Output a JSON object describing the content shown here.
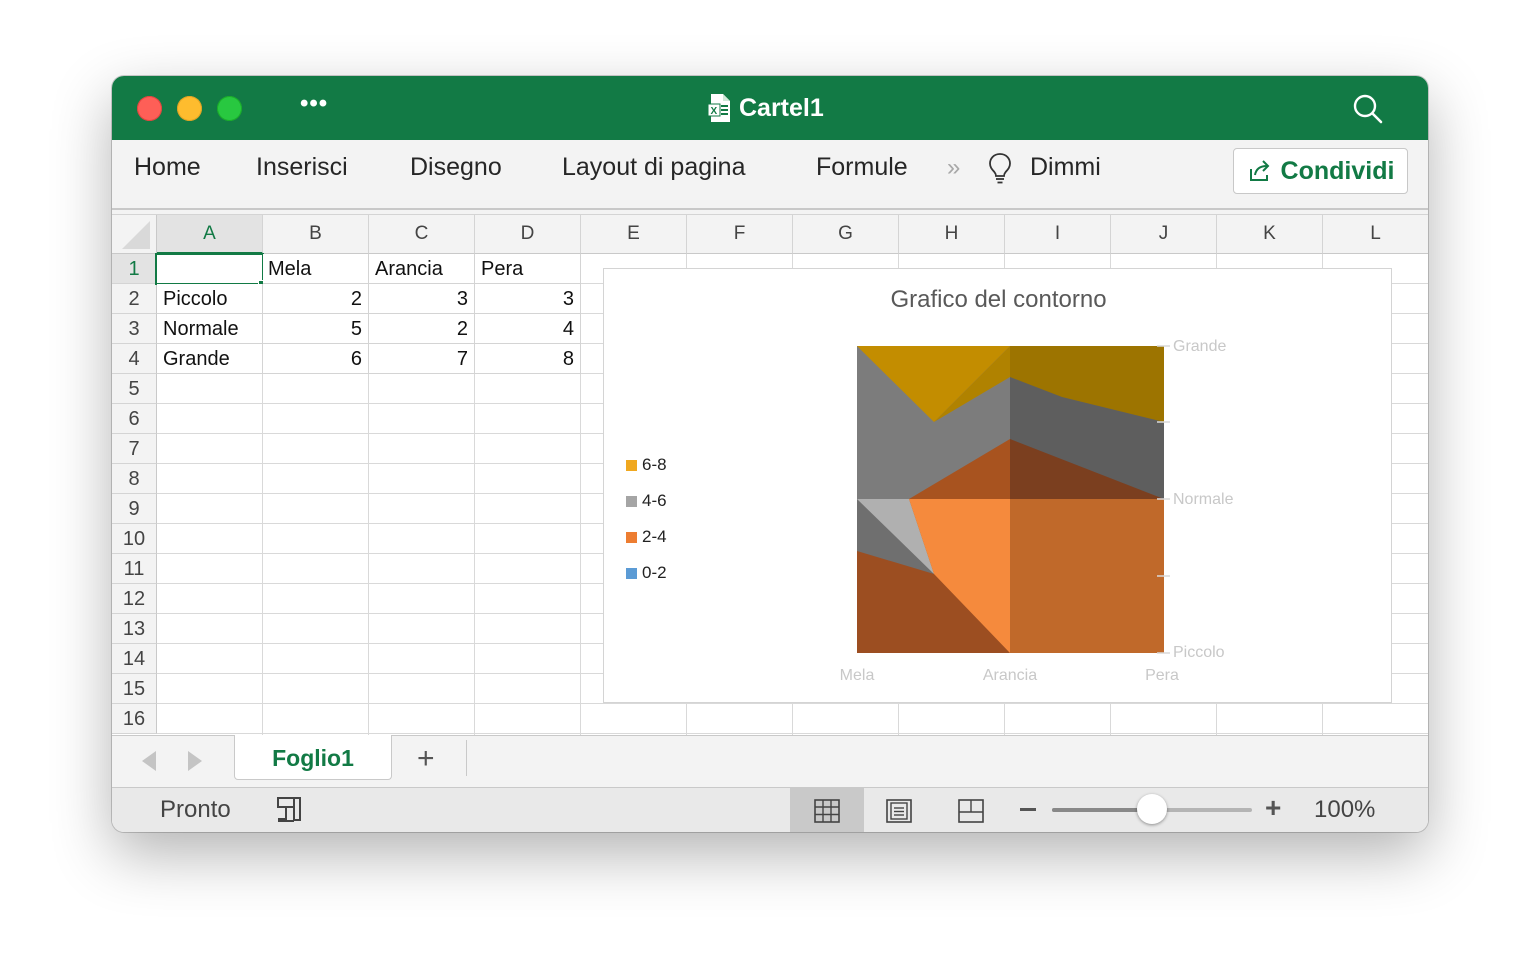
{
  "window": {
    "title": "Cartel1"
  },
  "ribbon": {
    "tabs": [
      "Home",
      "Inserisci",
      "Disegno",
      "Layout di pagina",
      "Formule"
    ],
    "more_chevron": "»",
    "tell_me": "Dimmi",
    "share_label": "Condividi"
  },
  "sheet": {
    "columns": [
      "A",
      "B",
      "C",
      "D",
      "E",
      "F",
      "G",
      "H",
      "I",
      "J",
      "K",
      "L"
    ],
    "rows": [
      "1",
      "2",
      "3",
      "4",
      "5",
      "6",
      "7",
      "8",
      "9",
      "10",
      "11",
      "12",
      "13",
      "14",
      "15",
      "16"
    ],
    "selected_cell": "A1",
    "cells": {
      "B1": "Mela",
      "C1": "Arancia",
      "D1": "Pera",
      "A2": "Piccolo",
      "B2": "2",
      "C2": "3",
      "D2": "3",
      "A3": "Normale",
      "B3": "5",
      "C3": "2",
      "D3": "4",
      "A4": "Grande",
      "B4": "6",
      "C4": "7",
      "D4": "8"
    }
  },
  "chart_data": {
    "type": "contour",
    "title": "Grafico del contorno",
    "x": [
      "Mela",
      "Arancia",
      "Pera"
    ],
    "y": [
      "Piccolo",
      "Normale",
      "Grande"
    ],
    "z": [
      [
        2,
        3,
        3
      ],
      [
        5,
        2,
        4
      ],
      [
        6,
        7,
        8
      ]
    ],
    "legend": [
      {
        "label": "6-8",
        "color": "#f0a81f"
      },
      {
        "label": "4-6",
        "color": "#a5a5a5"
      },
      {
        "label": "2-4",
        "color": "#ed7d31"
      },
      {
        "label": "0-2",
        "color": "#5b9bd5"
      }
    ],
    "legend_position": "left"
  },
  "tabs_bar": {
    "sheets": [
      "Foglio1"
    ],
    "add_label": "+"
  },
  "status": {
    "text": "Pronto",
    "zoom": "100%",
    "zoom_level": 0.5
  },
  "icons": [
    "excel-file-icon",
    "search-icon",
    "lightbulb-icon",
    "share-icon",
    "macro-record-icon",
    "normal-view-icon",
    "page-layout-icon",
    "page-break-icon"
  ]
}
